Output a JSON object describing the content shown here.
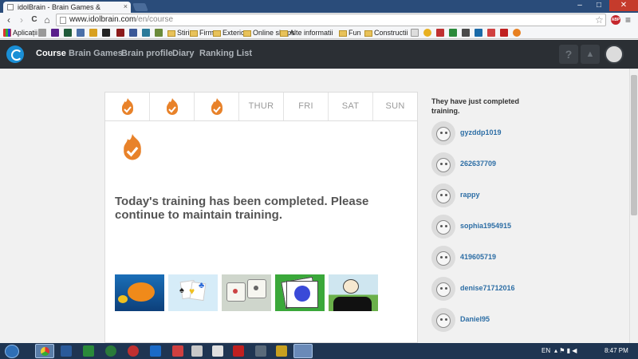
{
  "browser": {
    "tab_title": "idolBrain - Brain Games &",
    "tab_close": "×",
    "user_label": "",
    "min_label": "–",
    "max_label": "□",
    "close_label": "✕",
    "url_host": "www.idolbrain.com",
    "url_path": "/en/course",
    "back_icon": "‹",
    "forward_icon": "›",
    "reload_icon": "C",
    "home_icon": "⌂",
    "star_icon": "☆",
    "abp_label": "ABP",
    "menu_icon": "≡",
    "bookmarks": [
      {
        "label": "Aplicații",
        "type": "apps"
      },
      {
        "label": "Stiri",
        "type": "folder"
      },
      {
        "label": "Firme",
        "type": "folder"
      },
      {
        "label": "Exterior",
        "type": "folder"
      },
      {
        "label": "Online shops",
        "type": "folder"
      },
      {
        "label": "Alte informatii",
        "type": "folder"
      },
      {
        "label": "Fun",
        "type": "folder"
      },
      {
        "label": "Constructii",
        "type": "folder"
      }
    ]
  },
  "nav": {
    "items": [
      "Course",
      "Brain Games",
      "Brain profile",
      "Diary",
      "Ranking List"
    ],
    "active_index": 0,
    "help_label": "?",
    "bell_label": "▲"
  },
  "week": {
    "days": [
      {
        "label": "",
        "completed": true
      },
      {
        "label": "",
        "completed": true
      },
      {
        "label": "",
        "completed": true
      },
      {
        "label": "THUR",
        "completed": false
      },
      {
        "label": "FRI",
        "completed": false
      },
      {
        "label": "SAT",
        "completed": false
      },
      {
        "label": "SUN",
        "completed": false
      }
    ]
  },
  "main": {
    "message": "Today's training has been completed. Please continue to maintain training.",
    "games": [
      "fish-game",
      "cards-heart-game",
      "dice-game",
      "card-fan-game",
      "cartoon-scene-game"
    ]
  },
  "sidebar": {
    "title": "They have just completed training.",
    "users": [
      "gyzddp1019",
      "262637709",
      "rappy",
      "sophia1954915",
      "419605719",
      "denise71712016",
      "Daniel95"
    ]
  },
  "taskbar": {
    "lang": "EN",
    "time": "8:47 PM"
  },
  "colors": {
    "accent": "#e8822a",
    "nav_bg": "#2b2f34",
    "link": "#2d6ea5"
  }
}
